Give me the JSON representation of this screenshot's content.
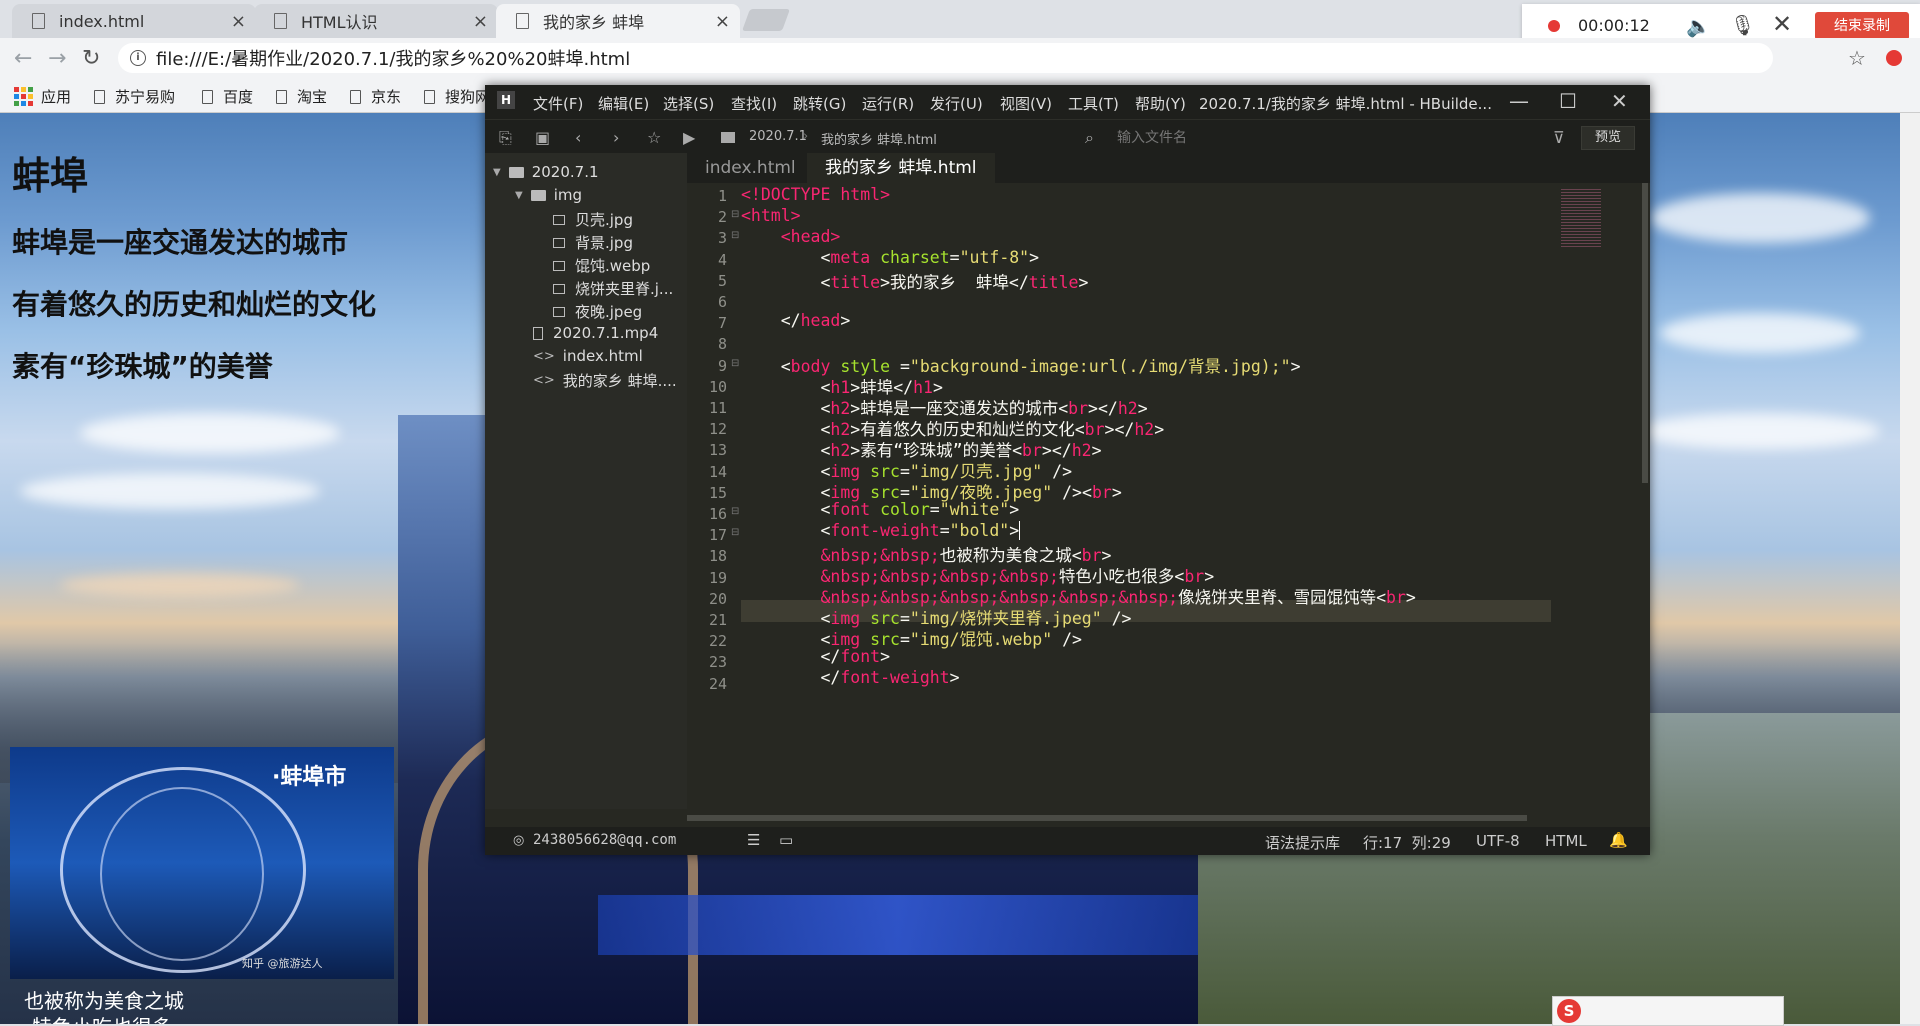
{
  "browser": {
    "tabs": [
      {
        "label": "index.html"
      },
      {
        "label": "HTML认识"
      },
      {
        "label": "我的家乡 蚌埠"
      }
    ],
    "address": "file:///E:/暑期作业/2020.7.1/我的家乡%20%20蚌埠.html",
    "bookmarks": [
      {
        "label": "应用"
      },
      {
        "label": "苏宁易购"
      },
      {
        "label": "百度"
      },
      {
        "label": "淘宝"
      },
      {
        "label": "京东"
      },
      {
        "label": "搜狗网"
      }
    ]
  },
  "recorder": {
    "time": "00:00:12",
    "end_label": "结束录制"
  },
  "webpage": {
    "h1": "蚌埠",
    "h2_1": "蚌埠是一座交通发达的城市",
    "h2_2": "有着悠久的历史和灿烂的文化",
    "h2_3": "素有“珍珠城”的美誉",
    "photo_caption": "·蚌埠市",
    "photo_watermark": "知乎 @旅游达人",
    "text_1": "也被称为美食之城",
    "text_2": "特色小吃也很多"
  },
  "hbuilder": {
    "menu": [
      "文件(F)",
      "编辑(E)",
      "选择(S)",
      "查找(I)",
      "跳转(G)",
      "运行(R)",
      "发行(U)",
      "视图(V)",
      "工具(T)",
      "帮助(Y)"
    ],
    "title": "2020.7.1/我的家乡  蚌埠.html - HBuilde...",
    "breadcrumb_1": "2020.7.1",
    "breadcrumb_2": "我的家乡  蚌埠.html",
    "file_filter_placeholder": "输入文件名",
    "preview_label": "预览",
    "tree": [
      {
        "label": "2020.7.1"
      },
      {
        "label": "img"
      },
      {
        "label": "贝壳.jpg"
      },
      {
        "label": "背景.jpg"
      },
      {
        "label": "馄饨.webp"
      },
      {
        "label": "烧饼夹里脊.j..."
      },
      {
        "label": "夜晚.jpeg"
      },
      {
        "label": "2020.7.1.mp4"
      },
      {
        "label": "index.html"
      },
      {
        "label": "我的家乡  蚌埠...."
      }
    ],
    "editor_tabs": [
      {
        "label": "index.html"
      },
      {
        "label": "我的家乡  蚌埠.html"
      }
    ],
    "status": {
      "user": "2438056628@qq.com",
      "syntax": "语法提示库",
      "position": "行:17  列:29",
      "encoding": "UTF-8",
      "language": "HTML"
    },
    "line_numbers": [
      "1",
      "2",
      "3",
      "4",
      "5",
      "6",
      "7",
      "8",
      "9",
      "10",
      "11",
      "12",
      "13",
      "14",
      "15",
      "16",
      "17",
      "18",
      "19",
      "20",
      "21",
      "22",
      "23",
      "24"
    ],
    "code": {
      "l1": "<!DOCTYPE html>",
      "l2": "<html>",
      "l3": "<head>",
      "l4_tag": "meta",
      "l4_attr": "charset",
      "l4_val": "\"utf-8\"",
      "l5_open": "title",
      "l5_text": "我的家乡  蚌埠",
      "l5_close": "title",
      "l7": "head",
      "l9_tag": "body",
      "l9_attr": "style",
      "l9_val": "\"background-image:url(./img/背景.jpg);\"",
      "l10_text": "蚌埠",
      "l11_text": "蚌埠是一座交通发达的城市",
      "l12_text": "有着悠久的历史和灿烂的文化",
      "l13_text": "素有“珍珠城”的美誉",
      "l14_val": "\"img/贝壳.jpg\"",
      "l15_val": "\"img/夜晚.jpeg\"",
      "l16_attr": "color",
      "l16_val": "\"white\"",
      "l17_attr": "font-weight",
      "l17_val": "\"bold\"",
      "l18_ent": "&nbsp;&nbsp;",
      "l18_text": "也被称为美食之城",
      "l19_ent": "&nbsp;&nbsp;&nbsp;&nbsp;",
      "l19_text": "特色小吃也很多",
      "l20_ent": "&nbsp;&nbsp;&nbsp;&nbsp;&nbsp;&nbsp;",
      "l20_text": "像烧饼夹里脊、雪园馄饨等",
      "l21_val": "\"img/烧饼夹里脊.jpeg\"",
      "l22_val": "\"img/馄饨.webp\"",
      "l23": "font",
      "l24": "font-weight"
    }
  },
  "colors": {
    "tag": "#f92672",
    "attr": "#a6e22e",
    "string": "#e6db74",
    "editor_bg": "#272822",
    "recorder_btn": "#e0493a"
  }
}
